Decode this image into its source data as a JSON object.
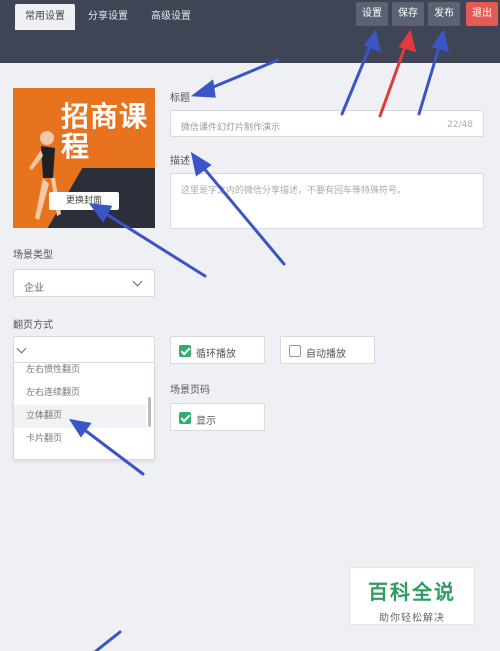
{
  "toolbar": {
    "settings_label": "设置",
    "save_label": "保存",
    "publish_label": "发布",
    "exit_label": "退出"
  },
  "tabs": [
    "常用设置",
    "分享设置",
    "高级设置"
  ],
  "cover": {
    "title_text": "招商课程",
    "change_button": "更换封面"
  },
  "title_field": {
    "label": "标题",
    "value": "微信课件幻灯片制作演示",
    "counter": "22/48"
  },
  "description_field": {
    "label": "描述",
    "placeholder": "这里是字之内的微信分享描述，不要有回车等特殊符号。"
  },
  "scene_type": {
    "label": "场景类型",
    "value": "企业"
  },
  "page_turn": {
    "label": "翻页方式",
    "options": [
      "左右惯性翻页",
      "左右连续翻页",
      "立体翻页",
      "卡片翻页"
    ]
  },
  "loop_play": {
    "label": "循环播放",
    "checked": true
  },
  "auto_play": {
    "label": "自动播放",
    "checked": false
  },
  "scene_page_number": {
    "label": "场景页码",
    "option_label": "显示",
    "checked": true
  },
  "watermark": {
    "title": "百科全说",
    "subtitle": "助你轻松解决"
  },
  "colors": {
    "topbar": "#3f4555",
    "exit_button": "#e65a55",
    "check_green": "#2fae6e",
    "arrow_blue": "#3a55c6",
    "arrow_red": "#e23a3a"
  }
}
